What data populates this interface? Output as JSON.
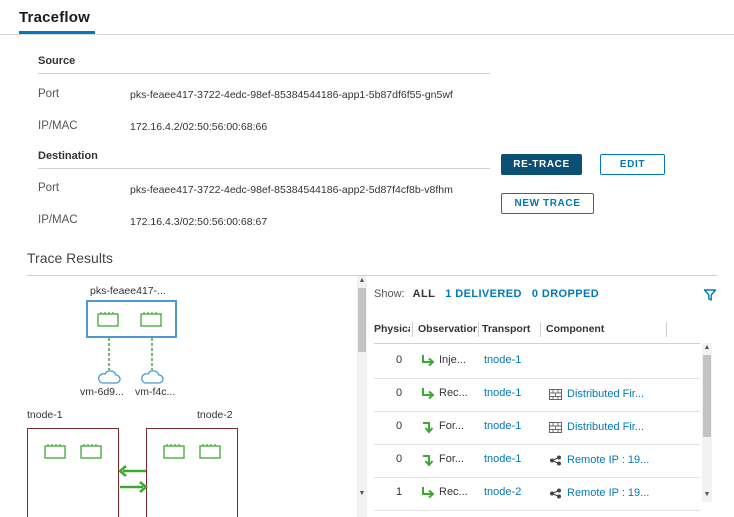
{
  "page_title": "Traceflow",
  "source": {
    "heading": "Source",
    "port_label": "Port",
    "port_value": "pks-feaee417-3722-4edc-98ef-85384544186-app1-5b87df6f55-gn5wf",
    "ipmac_label": "IP/MAC",
    "ipmac_value": "172.16.4.2/02:50:56:00:68:66"
  },
  "destination": {
    "heading": "Destination",
    "port_label": "Port",
    "port_value": "pks-feaee417-3722-4edc-98ef-85384544186-app2-5d87f4cf8b-v8fhm",
    "ipmac_label": "IP/MAC",
    "ipmac_value": "172.16.4.3/02:50:56:00:68:67"
  },
  "buttons": {
    "retrace": "RE-TRACE",
    "edit": "EDIT",
    "new_trace": "NEW TRACE"
  },
  "trace_results": {
    "heading": "Trace Results",
    "topology": {
      "pod_label": "pks-feaee417-...",
      "vm_left": "vm-6d9...",
      "vm_right": "vm-f4c...",
      "tnode_left": "tnode-1",
      "tnode_right": "tnode-2"
    },
    "filters": {
      "show_label": "Show:",
      "all": "ALL",
      "delivered": "1 DELIVERED",
      "dropped": "0 DROPPED"
    },
    "columns": [
      "Physical",
      "Observation",
      "Transport",
      "Component"
    ],
    "rows": [
      {
        "physical": "0",
        "observation": "Inje...",
        "obs_icon": "received-arrow-icon",
        "transport": "tnode-1",
        "component": "",
        "comp_icon": ""
      },
      {
        "physical": "0",
        "observation": "Rec...",
        "obs_icon": "received-arrow-icon",
        "transport": "tnode-1",
        "component": "Distributed Fir...",
        "comp_icon": "firewall-icon"
      },
      {
        "physical": "0",
        "observation": "For...",
        "obs_icon": "forwarded-arrow-icon",
        "transport": "tnode-1",
        "component": "Distributed Fir...",
        "comp_icon": "firewall-icon"
      },
      {
        "physical": "0",
        "observation": "For...",
        "obs_icon": "forwarded-arrow-icon",
        "transport": "tnode-1",
        "component": "Remote IP : 19...",
        "comp_icon": "share-icon"
      },
      {
        "physical": "1",
        "observation": "Rec...",
        "obs_icon": "received-arrow-icon",
        "transport": "tnode-2",
        "component": "Remote IP : 19...",
        "comp_icon": "share-icon"
      }
    ]
  },
  "colors": {
    "accent": "#0079b8",
    "primary_button": "#0b4f74",
    "pod_border": "#4a9bd1",
    "tnode_border": "#7a2a2a",
    "arrow_green": "#3ea832"
  }
}
